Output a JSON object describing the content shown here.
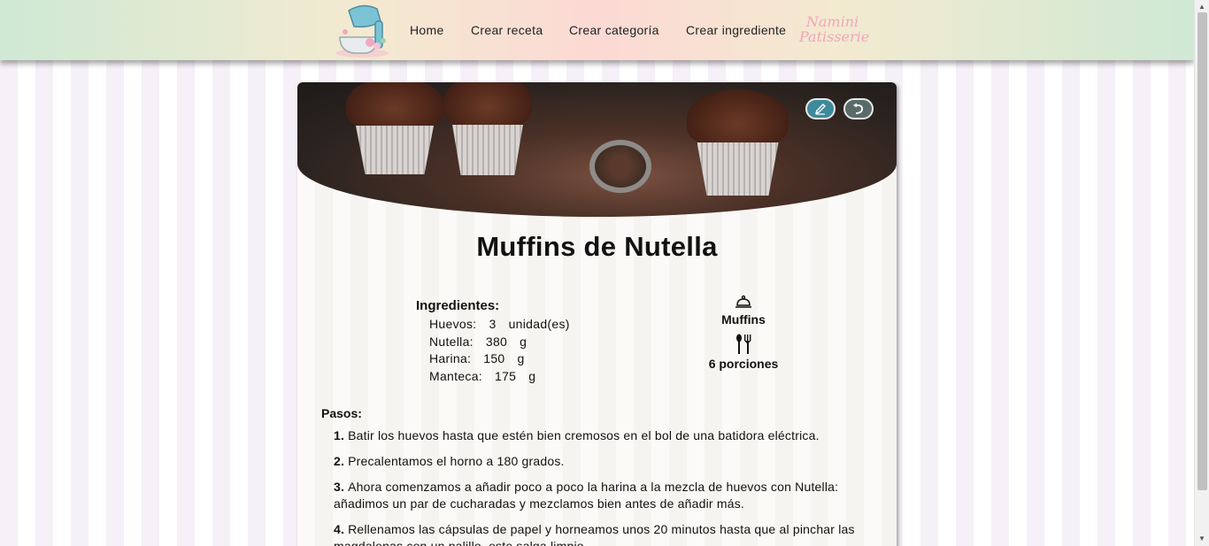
{
  "navbar": {
    "links": [
      "Home",
      "Crear receta",
      "Crear categoría",
      "Crear ingrediente"
    ],
    "brand": "Namini Patisserie"
  },
  "recipe": {
    "title": "Muffins de Nutella",
    "edit_icon": "pencil-icon",
    "back_icon": "return-arrow-icon",
    "ingredients_title": "Ingredientes:",
    "ingredients": [
      {
        "name": "Huevos:",
        "qty": "3",
        "unit": "unidad(es)"
      },
      {
        "name": "Nutella:",
        "qty": "380",
        "unit": "g"
      },
      {
        "name": "Harina:",
        "qty": "150",
        "unit": "g"
      },
      {
        "name": "Manteca:",
        "qty": "175",
        "unit": "g"
      }
    ],
    "category": "Muffins",
    "portions": "6 porciones",
    "steps_title": "Pasos:",
    "steps": [
      {
        "num": "1.",
        "text": "Batir los huevos hasta que estén bien cremosos en el bol de una batidora eléctrica."
      },
      {
        "num": "2.",
        "text": "Precalentamos el horno a 180 grados."
      },
      {
        "num": "3.",
        "text": "Ahora comenzamos a añadir poco a poco la harina a la mezcla de huevos con Nutella: añadimos un par de cucharadas y mezclamos bien antes de añadir más."
      },
      {
        "num": "4.",
        "text": "Rellenamos las cápsulas de papel y horneamos unos 20 minutos hasta que al pinchar las magdalenas con un palillo, este salga limpio."
      }
    ]
  },
  "colors": {
    "edit_button": "#3d8a9a",
    "back_button": "#5a6c6a",
    "brand_pink": "#f0a5bd"
  }
}
